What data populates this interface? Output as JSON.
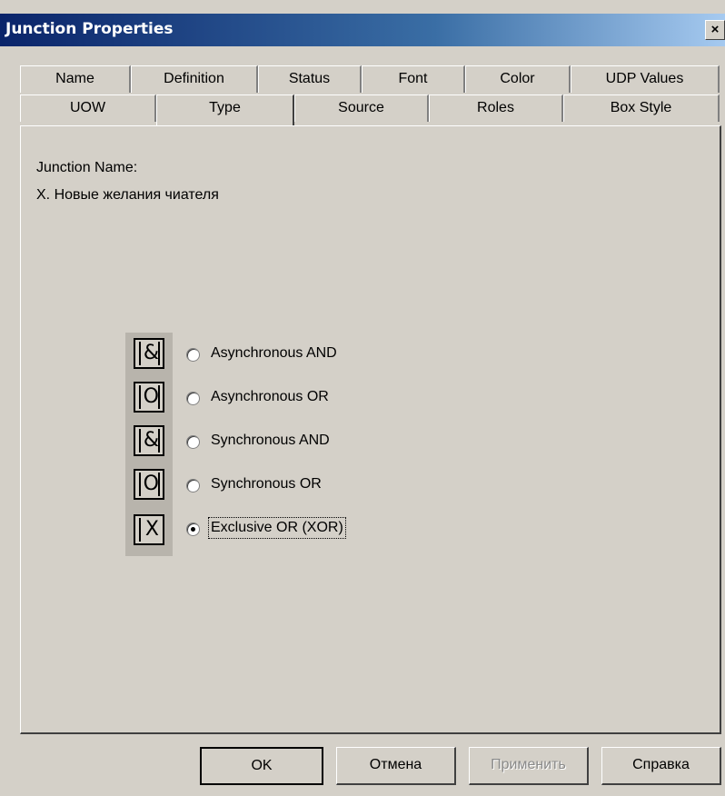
{
  "window": {
    "title": "Junction Properties",
    "close_glyph": "×"
  },
  "tabs_row1": [
    "Name",
    "Definition",
    "Status",
    "Font",
    "Color",
    "UDP Values"
  ],
  "tabs_row2": [
    "UOW",
    "Type",
    "Source",
    "Roles",
    "Box Style"
  ],
  "active_tab": "Type",
  "junction": {
    "name_label": "Junction Name:",
    "name_value": "X. Новые желания чиателя"
  },
  "icons": [
    {
      "name": "async-and-icon",
      "glyph": "&"
    },
    {
      "name": "async-or-icon",
      "glyph": "O"
    },
    {
      "name": "sync-and-icon",
      "glyph": "&"
    },
    {
      "name": "sync-or-icon",
      "glyph": "O"
    },
    {
      "name": "xor-icon",
      "glyph": "X"
    }
  ],
  "options": [
    {
      "label": "Asynchronous AND",
      "checked": false
    },
    {
      "label": "Asynchronous OR",
      "checked": false
    },
    {
      "label": "Synchronous AND",
      "checked": false
    },
    {
      "label": "Synchronous OR",
      "checked": false
    },
    {
      "label": "Exclusive OR (XOR)",
      "checked": true
    }
  ],
  "buttons": {
    "ok": "OK",
    "cancel": "Отмена",
    "apply": "Применить",
    "help": "Справка"
  }
}
